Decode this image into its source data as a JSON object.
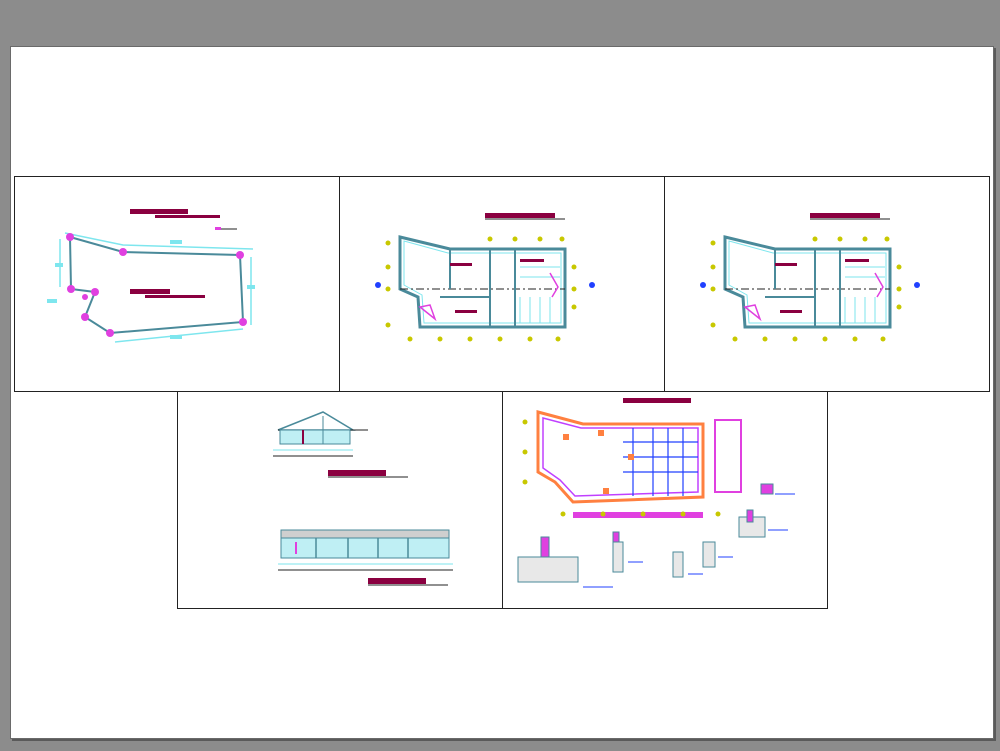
{
  "viewer": {
    "background_color": "#8c8c8c",
    "sheet_color": "#ffffff"
  },
  "palette": {
    "outline": "#4a8a9a",
    "dimension": "#7ee6ee",
    "node": "#e040e0",
    "title_bar": "#8a0040",
    "grid_marker": "#c8c800",
    "blue_detail": "#2040ff"
  },
  "sheets": [
    {
      "id": "site-plan",
      "kind": "site-boundary"
    },
    {
      "id": "floor-plan-a",
      "kind": "floor-plan"
    },
    {
      "id": "floor-plan-b",
      "kind": "floor-plan"
    },
    {
      "id": "elevations",
      "kind": "sections"
    },
    {
      "id": "foundation-plan",
      "kind": "foundation-and-details"
    }
  ]
}
